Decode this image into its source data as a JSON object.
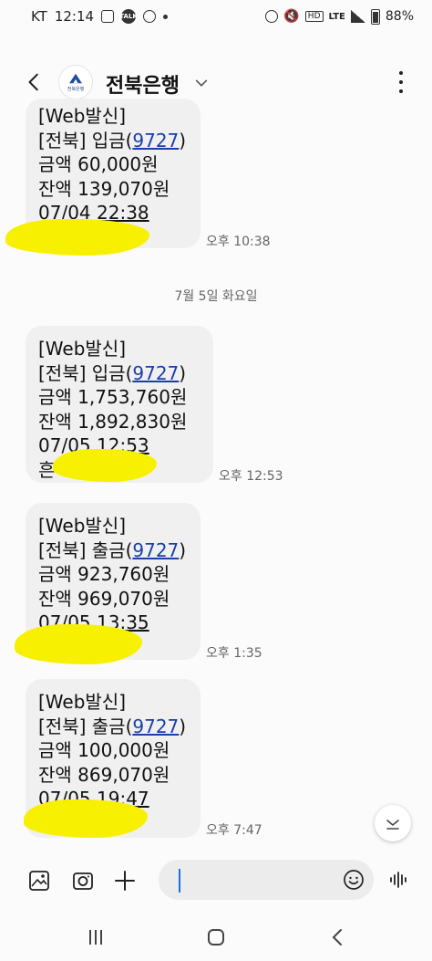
{
  "status_bar": {
    "carrier": "KT",
    "time": "12:14",
    "network": "LTE",
    "battery": "88%"
  },
  "header": {
    "contact_name": "전북은행",
    "avatar_text": "전북은행",
    "icons": [
      "back-icon",
      "chevron-down-icon",
      "more-vert-icon"
    ]
  },
  "messages": [
    {
      "lines": [
        "[Web발신]",
        "[전북] 입금(9727)",
        "금액 60,000원",
        "잔액 139,070원",
        "07/04 22:38"
      ],
      "link_text": "9727",
      "time": "오후 10:38"
    },
    {
      "lines": [
        "[Web발신]",
        "[전북] 입금(9727)",
        "금액 1,753,760원",
        "잔액 1,892,830원",
        "07/05 12:53",
        "흔        기공소"
      ],
      "link_text": "9727",
      "time": "오후 12:53"
    },
    {
      "lines": [
        "[Web발신]",
        "[전북] 출금(9727)",
        "금액 923,760원",
        "잔액 969,070원",
        "07/05 13:35"
      ],
      "link_text": "9727",
      "time": "오후 1:35"
    },
    {
      "lines": [
        "[Web발신]",
        "[전북] 출금(9727)",
        "금액 100,000원",
        "잔액 869,070원",
        "07/05 19:47"
      ],
      "link_text": "9727",
      "time": "오후 7:47"
    }
  ],
  "date_separator": "7월 5일 화요일",
  "input_bar": {
    "placeholder": "",
    "icons": [
      "gallery-icon",
      "camera-icon",
      "plus-icon",
      "emoji-icon",
      "voice-icon"
    ]
  },
  "colors": {
    "link": "#1b3fa8",
    "bubble_bg": "#f0f0f0",
    "highlight_scribble": "#f7f000",
    "caret": "#1d6fe0"
  }
}
